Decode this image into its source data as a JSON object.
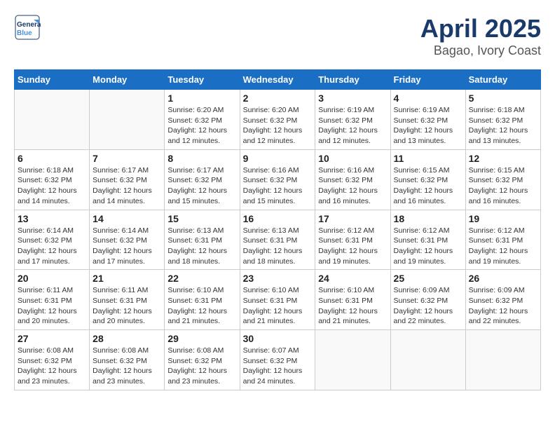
{
  "header": {
    "logo_line1": "General",
    "logo_line2": "Blue",
    "title": "April 2025",
    "subtitle": "Bagao, Ivory Coast"
  },
  "weekdays": [
    "Sunday",
    "Monday",
    "Tuesday",
    "Wednesday",
    "Thursday",
    "Friday",
    "Saturday"
  ],
  "weeks": [
    [
      {
        "day": "",
        "info": ""
      },
      {
        "day": "",
        "info": ""
      },
      {
        "day": "1",
        "info": "Sunrise: 6:20 AM\nSunset: 6:32 PM\nDaylight: 12 hours and 12 minutes."
      },
      {
        "day": "2",
        "info": "Sunrise: 6:20 AM\nSunset: 6:32 PM\nDaylight: 12 hours and 12 minutes."
      },
      {
        "day": "3",
        "info": "Sunrise: 6:19 AM\nSunset: 6:32 PM\nDaylight: 12 hours and 12 minutes."
      },
      {
        "day": "4",
        "info": "Sunrise: 6:19 AM\nSunset: 6:32 PM\nDaylight: 12 hours and 13 minutes."
      },
      {
        "day": "5",
        "info": "Sunrise: 6:18 AM\nSunset: 6:32 PM\nDaylight: 12 hours and 13 minutes."
      }
    ],
    [
      {
        "day": "6",
        "info": "Sunrise: 6:18 AM\nSunset: 6:32 PM\nDaylight: 12 hours and 14 minutes."
      },
      {
        "day": "7",
        "info": "Sunrise: 6:17 AM\nSunset: 6:32 PM\nDaylight: 12 hours and 14 minutes."
      },
      {
        "day": "8",
        "info": "Sunrise: 6:17 AM\nSunset: 6:32 PM\nDaylight: 12 hours and 15 minutes."
      },
      {
        "day": "9",
        "info": "Sunrise: 6:16 AM\nSunset: 6:32 PM\nDaylight: 12 hours and 15 minutes."
      },
      {
        "day": "10",
        "info": "Sunrise: 6:16 AM\nSunset: 6:32 PM\nDaylight: 12 hours and 16 minutes."
      },
      {
        "day": "11",
        "info": "Sunrise: 6:15 AM\nSunset: 6:32 PM\nDaylight: 12 hours and 16 minutes."
      },
      {
        "day": "12",
        "info": "Sunrise: 6:15 AM\nSunset: 6:32 PM\nDaylight: 12 hours and 16 minutes."
      }
    ],
    [
      {
        "day": "13",
        "info": "Sunrise: 6:14 AM\nSunset: 6:32 PM\nDaylight: 12 hours and 17 minutes."
      },
      {
        "day": "14",
        "info": "Sunrise: 6:14 AM\nSunset: 6:32 PM\nDaylight: 12 hours and 17 minutes."
      },
      {
        "day": "15",
        "info": "Sunrise: 6:13 AM\nSunset: 6:31 PM\nDaylight: 12 hours and 18 minutes."
      },
      {
        "day": "16",
        "info": "Sunrise: 6:13 AM\nSunset: 6:31 PM\nDaylight: 12 hours and 18 minutes."
      },
      {
        "day": "17",
        "info": "Sunrise: 6:12 AM\nSunset: 6:31 PM\nDaylight: 12 hours and 19 minutes."
      },
      {
        "day": "18",
        "info": "Sunrise: 6:12 AM\nSunset: 6:31 PM\nDaylight: 12 hours and 19 minutes."
      },
      {
        "day": "19",
        "info": "Sunrise: 6:12 AM\nSunset: 6:31 PM\nDaylight: 12 hours and 19 minutes."
      }
    ],
    [
      {
        "day": "20",
        "info": "Sunrise: 6:11 AM\nSunset: 6:31 PM\nDaylight: 12 hours and 20 minutes."
      },
      {
        "day": "21",
        "info": "Sunrise: 6:11 AM\nSunset: 6:31 PM\nDaylight: 12 hours and 20 minutes."
      },
      {
        "day": "22",
        "info": "Sunrise: 6:10 AM\nSunset: 6:31 PM\nDaylight: 12 hours and 21 minutes."
      },
      {
        "day": "23",
        "info": "Sunrise: 6:10 AM\nSunset: 6:31 PM\nDaylight: 12 hours and 21 minutes."
      },
      {
        "day": "24",
        "info": "Sunrise: 6:10 AM\nSunset: 6:31 PM\nDaylight: 12 hours and 21 minutes."
      },
      {
        "day": "25",
        "info": "Sunrise: 6:09 AM\nSunset: 6:32 PM\nDaylight: 12 hours and 22 minutes."
      },
      {
        "day": "26",
        "info": "Sunrise: 6:09 AM\nSunset: 6:32 PM\nDaylight: 12 hours and 22 minutes."
      }
    ],
    [
      {
        "day": "27",
        "info": "Sunrise: 6:08 AM\nSunset: 6:32 PM\nDaylight: 12 hours and 23 minutes."
      },
      {
        "day": "28",
        "info": "Sunrise: 6:08 AM\nSunset: 6:32 PM\nDaylight: 12 hours and 23 minutes."
      },
      {
        "day": "29",
        "info": "Sunrise: 6:08 AM\nSunset: 6:32 PM\nDaylight: 12 hours and 23 minutes."
      },
      {
        "day": "30",
        "info": "Sunrise: 6:07 AM\nSunset: 6:32 PM\nDaylight: 12 hours and 24 minutes."
      },
      {
        "day": "",
        "info": ""
      },
      {
        "day": "",
        "info": ""
      },
      {
        "day": "",
        "info": ""
      }
    ]
  ]
}
